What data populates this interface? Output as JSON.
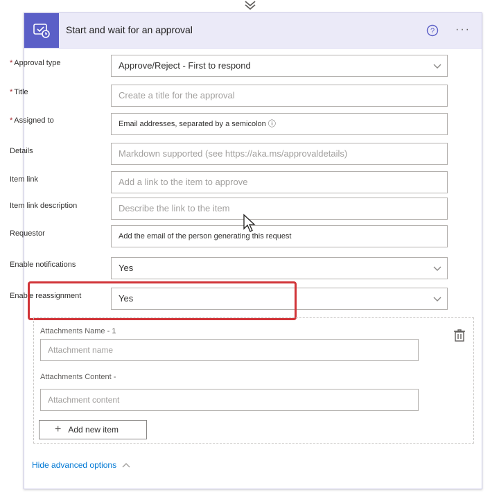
{
  "card": {
    "title": "Start and wait for an approval",
    "more_label": "···"
  },
  "fields": [
    {
      "label": "Approval type",
      "required": true,
      "value": "Approve/Reject - First to respond",
      "placeholder": false,
      "dropdown": true
    },
    {
      "label": "Title",
      "required": true,
      "value": "Create a title for the approval",
      "placeholder": true,
      "dropdown": false
    },
    {
      "label": "Assigned to",
      "required": true,
      "value": "Email addresses, separated by a semicolon ⓘ",
      "placeholder": false,
      "dropdown": false
    },
    {
      "label": "Details",
      "required": false,
      "value": "Markdown supported (see https://aka.ms/approvaldetails)",
      "placeholder": true,
      "dropdown": false
    },
    {
      "label": "Item link",
      "required": false,
      "value": "Add a link to the item to approve",
      "placeholder": true,
      "dropdown": false
    },
    {
      "label": "Item link description",
      "required": false,
      "value": "Describe the link to the item",
      "placeholder": true,
      "dropdown": false
    },
    {
      "label": "Requestor",
      "required": false,
      "value": "Add the email of the person generating this request",
      "placeholder": false,
      "dropdown": false
    },
    {
      "label": "Enable notifications",
      "required": false,
      "value": "Yes",
      "placeholder": false,
      "dropdown": true
    },
    {
      "label": "Enable reassignment",
      "required": false,
      "value": "Yes",
      "placeholder": false,
      "dropdown": true
    }
  ],
  "attachments": {
    "name_label": "Attachments Name - 1",
    "name_placeholder": "Attachment name",
    "content_label": "Attachments Content -",
    "content_placeholder": "Attachment content",
    "add_label": "Add new item"
  },
  "footer": {
    "hide_label": "Hide advanced options"
  },
  "colors": {
    "accent": "#5b5fc7",
    "highlight": "#d13438",
    "link": "#0078d4"
  }
}
